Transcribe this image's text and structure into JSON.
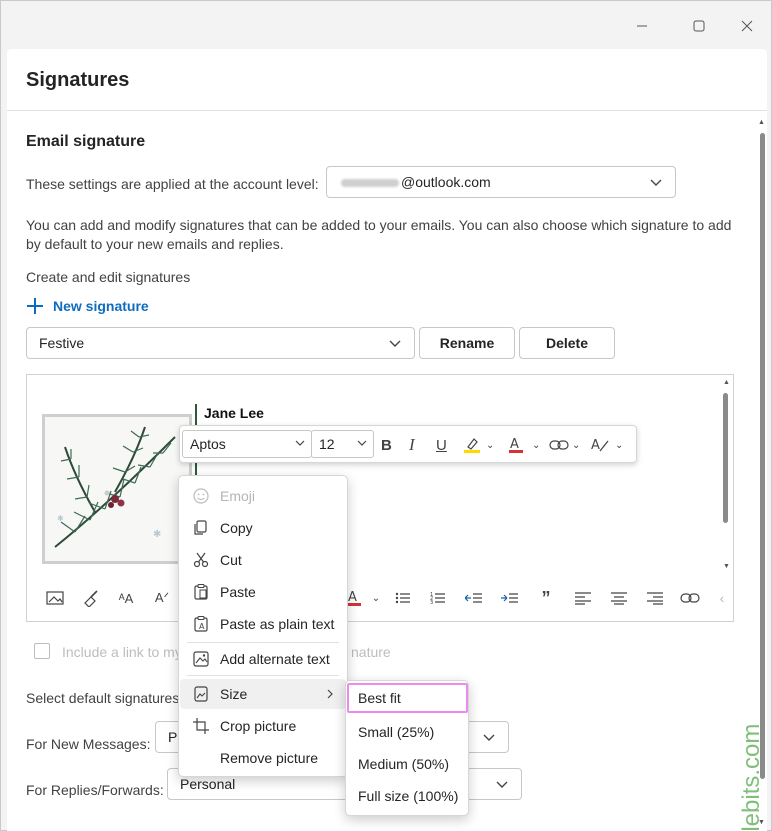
{
  "colors": {
    "accent": "#0f6cbd",
    "link": "#2b7a4b",
    "highlight_border": "#e98bf0",
    "watermark": "#7fbf7a"
  },
  "window": {
    "controls": [
      "minimize-icon",
      "maximize-icon",
      "close-icon"
    ]
  },
  "panel": {
    "title": "Signatures"
  },
  "section": {
    "heading": "Email signature",
    "account_label": "These settings are applied at the account level:",
    "account_value": "@outlook.com",
    "description_line1": "You can add and modify signatures that can be added to your emails. You can also choose which signature to add",
    "description_line2": "by default to your new emails and replies.",
    "create_label": "Create and edit signatures",
    "new_signature": "New signature",
    "signature_select_value": "Festive",
    "rename_label": "Rename",
    "delete_label": "Delete"
  },
  "editor": {
    "signature_name": "Jane Lee",
    "visible_link_fragment": "m"
  },
  "format_bar": {
    "font": "Aptos",
    "size": "12"
  },
  "include_link": {
    "label_start": "Include a link to my",
    "label_end": "nature"
  },
  "defaults": {
    "label": "Select default signatures",
    "new_messages_label": "For New Messages:",
    "new_messages_value": "Pe",
    "replies_label": "For Replies/Forwards:",
    "replies_value": "Personal"
  },
  "context_menu": {
    "items": [
      {
        "label": "Emoji",
        "icon": "emoji-icon",
        "disabled": true
      },
      {
        "label": "Copy",
        "icon": "copy-icon"
      },
      {
        "label": "Cut",
        "icon": "cut-icon"
      },
      {
        "label": "Paste",
        "icon": "paste-icon"
      },
      {
        "label": "Paste as plain text",
        "icon": "paste-plain-text-icon"
      },
      {
        "label": "Add alternate text",
        "icon": "alt-text-icon"
      },
      {
        "label": "Size",
        "icon": "size-icon",
        "has_submenu": true
      },
      {
        "label": "Crop picture",
        "icon": "crop-icon"
      },
      {
        "label": "Remove picture",
        "icon": ""
      }
    ]
  },
  "size_submenu": {
    "items": [
      "Best fit",
      "Small (25%)",
      "Medium (50%)",
      "Full size (100%)"
    ],
    "highlighted": "Best fit"
  },
  "watermark": {
    "text": "Ablebits.com"
  }
}
